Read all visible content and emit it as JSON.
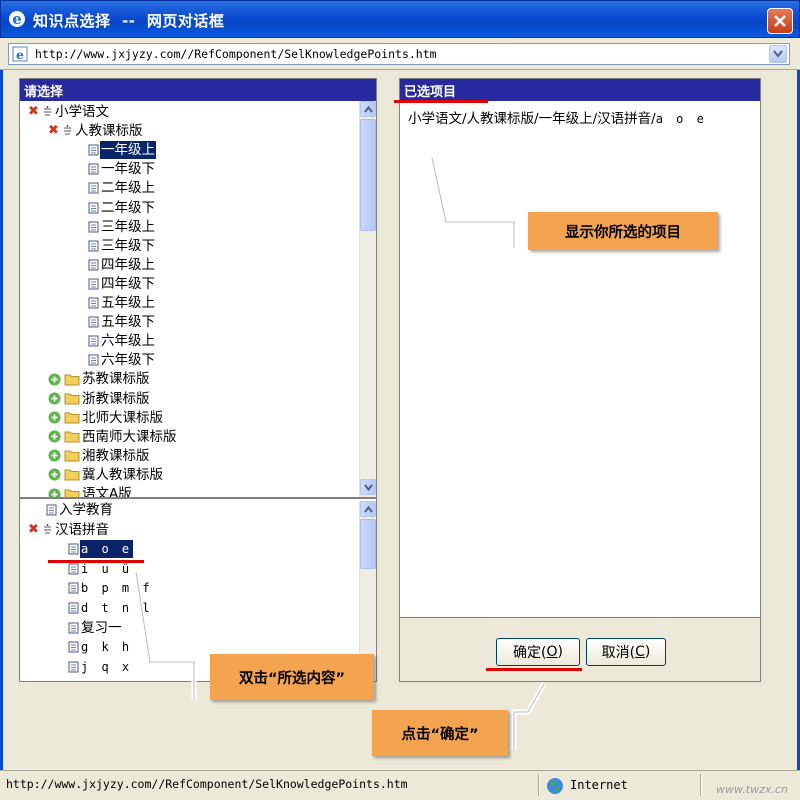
{
  "window": {
    "title": "知识点选择  --  网页对话框",
    "url": "http://www.jxjyzy.com//RefComponent/SelKnowledgePoints.htm"
  },
  "left_panel": {
    "header": "请选择",
    "tree_top": [
      {
        "label": "小学语文",
        "icon": "minus-icon",
        "mark": "x-icon",
        "level": 0
      },
      {
        "label": "人教课标版",
        "icon": "minus-icon",
        "mark": "x-icon",
        "level": 1
      },
      {
        "label": "一年级上",
        "icon": "doc-icon",
        "level": 2,
        "selected": true
      },
      {
        "label": "一年级下",
        "icon": "doc-icon",
        "level": 2
      },
      {
        "label": "二年级上",
        "icon": "doc-icon",
        "level": 2
      },
      {
        "label": "二年级下",
        "icon": "doc-icon",
        "level": 2
      },
      {
        "label": "三年级上",
        "icon": "doc-icon",
        "level": 2
      },
      {
        "label": "三年级下",
        "icon": "doc-icon",
        "level": 2
      },
      {
        "label": "四年级上",
        "icon": "doc-icon",
        "level": 2
      },
      {
        "label": "四年级下",
        "icon": "doc-icon",
        "level": 2
      },
      {
        "label": "五年级上",
        "icon": "doc-icon",
        "level": 2
      },
      {
        "label": "五年级下",
        "icon": "doc-icon",
        "level": 2
      },
      {
        "label": "六年级上",
        "icon": "doc-icon",
        "level": 2
      },
      {
        "label": "六年级下",
        "icon": "doc-icon",
        "level": 2
      },
      {
        "label": "苏教课标版",
        "icon": "folder-icon",
        "mark": "plus-icon",
        "level": 1
      },
      {
        "label": "浙教课标版",
        "icon": "folder-icon",
        "mark": "plus-icon",
        "level": 1
      },
      {
        "label": "北师大课标版",
        "icon": "folder-icon",
        "mark": "plus-icon",
        "level": 1
      },
      {
        "label": "西南师大课标版",
        "icon": "folder-icon",
        "mark": "plus-icon",
        "level": 1
      },
      {
        "label": "湘教课标版",
        "icon": "folder-icon",
        "mark": "plus-icon",
        "level": 1
      },
      {
        "label": "冀人教课标版",
        "icon": "folder-icon",
        "mark": "plus-icon",
        "level": 1
      },
      {
        "label": "语文A版",
        "icon": "folder-icon",
        "mark": "plus-icon",
        "level": 1
      }
    ],
    "tree_bottom": [
      {
        "label": "入学教育",
        "icon": "doc-icon",
        "level": 1
      },
      {
        "label": "汉语拼音",
        "icon": "minus-icon",
        "mark": "x-icon",
        "level": 0
      },
      {
        "label": "a o e",
        "icon": "doc-icon",
        "level": 2,
        "selected": true,
        "mono": true
      },
      {
        "label": "i u ü",
        "icon": "doc-icon",
        "level": 2,
        "mono": true
      },
      {
        "label": "b p m f",
        "icon": "doc-icon",
        "level": 2,
        "mono": true
      },
      {
        "label": "d t n l",
        "icon": "doc-icon",
        "level": 2,
        "mono": true
      },
      {
        "label": "复习一",
        "icon": "doc-icon",
        "level": 2
      },
      {
        "label": "g k h",
        "icon": "doc-icon",
        "level": 2,
        "mono": true
      },
      {
        "label": "j q x",
        "icon": "doc-icon",
        "level": 2,
        "mono": true
      }
    ]
  },
  "right_panel": {
    "header": "已选项目",
    "selected_path": "小学语文/人教课标版/一年级上/汉语拼音/",
    "selected_leaf": "a o e"
  },
  "buttons": {
    "ok_label": "确定(",
    "ok_key": "O",
    "cancel_label": "取消(",
    "cancel_key": "C",
    "close_paren": ")"
  },
  "annotations": {
    "show_selected": "显示你所选的项目",
    "double_click": "双击“所选内容”",
    "click_ok": "点击“确定”"
  },
  "statusbar": {
    "url": "http://www.jxjyzy.com//RefComponent/SelKnowledgePoints.htm",
    "zone": "Internet"
  },
  "watermark": "www.twzx.cn",
  "colors": {
    "titlebar": "#0a4ad2",
    "panel_header": "#282aa0",
    "selection": "#0a246a",
    "callout": "#f4a34f",
    "underline": "#e00000"
  }
}
